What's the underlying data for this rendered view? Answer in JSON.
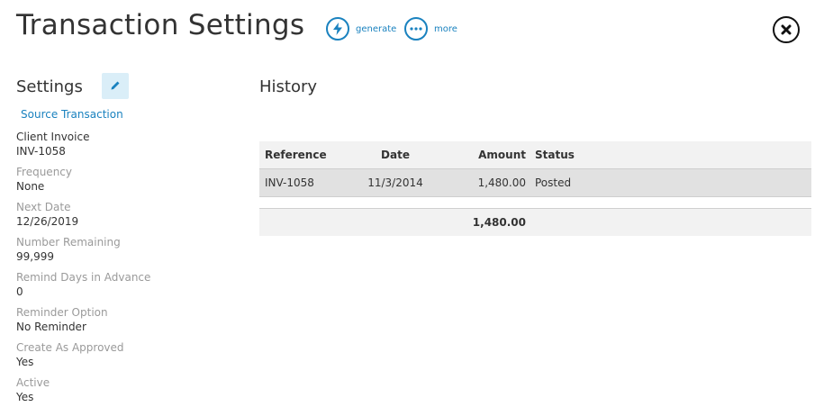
{
  "header": {
    "title": "Transaction Settings",
    "actions": [
      {
        "label": "generate",
        "icon": "lightning-icon"
      },
      {
        "label": "more",
        "icon": "ellipsis-icon"
      }
    ],
    "close_icon": "close-icon"
  },
  "settings": {
    "heading": "Settings",
    "source_link": "Source Transaction",
    "fields": [
      {
        "label": "Client Invoice",
        "value": "INV-1058"
      },
      {
        "label": "Frequency",
        "value": "None"
      },
      {
        "label": "Next Date",
        "value": "12/26/2019"
      },
      {
        "label": "Number Remaining",
        "value": "99,999"
      },
      {
        "label": "Remind Days in Advance",
        "value": "0"
      },
      {
        "label": "Reminder Option",
        "value": "No Reminder"
      },
      {
        "label": "Create As Approved",
        "value": "Yes"
      },
      {
        "label": "Active",
        "value": "Yes"
      }
    ]
  },
  "history": {
    "heading": "History",
    "columns": {
      "reference": "Reference",
      "date": "Date",
      "amount": "Amount",
      "status": "Status"
    },
    "rows": [
      {
        "reference": "INV-1058",
        "date": "11/3/2014",
        "amount": "1,480.00",
        "status": "Posted"
      }
    ],
    "total_amount": "1,480.00"
  },
  "colors": {
    "accent": "#1a82bf",
    "text": "#333333",
    "muted": "#9a9a9a"
  }
}
